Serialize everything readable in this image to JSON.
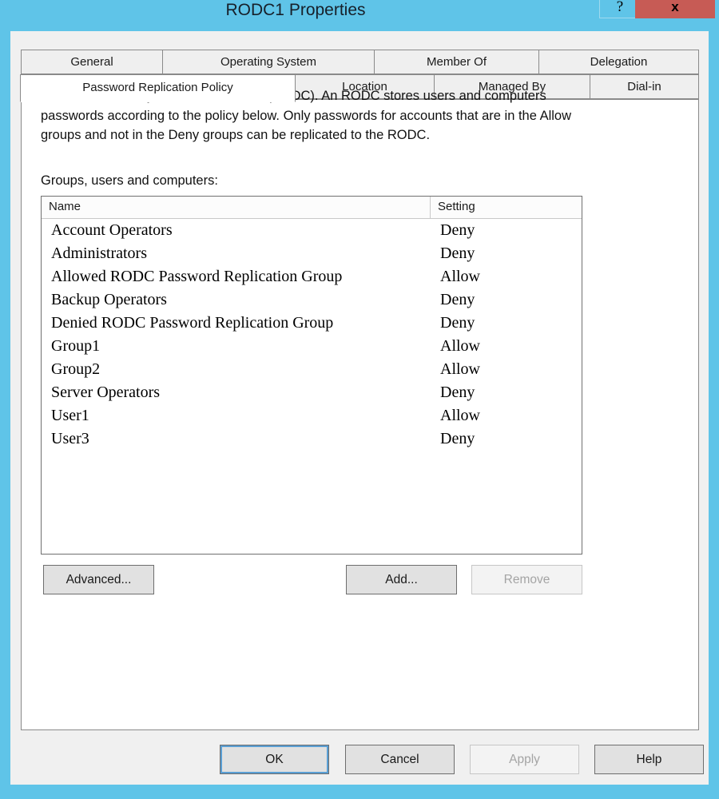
{
  "window": {
    "title": "RODC1 Properties",
    "accent_color": "#5FC4E8",
    "close_color": "#C75B55",
    "dialog_color": "#F0F0F0",
    "help_button_label": "?",
    "close_button_label": "x"
  },
  "tabs": {
    "row1": [
      {
        "label": "General",
        "active": false
      },
      {
        "label": "Operating System",
        "active": false
      },
      {
        "label": "Member Of",
        "active": false
      },
      {
        "label": "Delegation",
        "active": false
      }
    ],
    "row2": [
      {
        "label": "Password Replication Policy",
        "active": true
      },
      {
        "label": "Location",
        "active": false
      },
      {
        "label": "Managed By",
        "active": false
      },
      {
        "label": "Dial-in",
        "active": false
      }
    ]
  },
  "panel": {
    "description": "This is a Read-only Domain Controller (RODC).  An RODC stores users and computers passwords according to the policy below.  Only passwords for accounts that are in the Allow groups and not in the Deny groups can be replicated to the RODC.",
    "groups_label": "Groups, users and computers:",
    "list": {
      "columns": [
        "Name",
        "Setting"
      ],
      "rows": [
        {
          "name": "Account Operators",
          "setting": "Deny"
        },
        {
          "name": "Administrators",
          "setting": "Deny"
        },
        {
          "name": "Allowed RODC Password Replication Group",
          "setting": "Allow"
        },
        {
          "name": "Backup Operators",
          "setting": "Deny"
        },
        {
          "name": "Denied RODC Password Replication Group",
          "setting": "Deny"
        },
        {
          "name": "Group1",
          "setting": "Allow"
        },
        {
          "name": "Group2",
          "setting": "Allow"
        },
        {
          "name": "Server Operators",
          "setting": "Deny"
        },
        {
          "name": "User1",
          "setting": "Allow"
        },
        {
          "name": "User3",
          "setting": "Deny"
        }
      ]
    },
    "buttons": {
      "advanced": "Advanced...",
      "add": "Add...",
      "remove": "Remove"
    }
  },
  "footer": {
    "ok": "OK",
    "cancel": "Cancel",
    "apply": "Apply",
    "help": "Help"
  }
}
